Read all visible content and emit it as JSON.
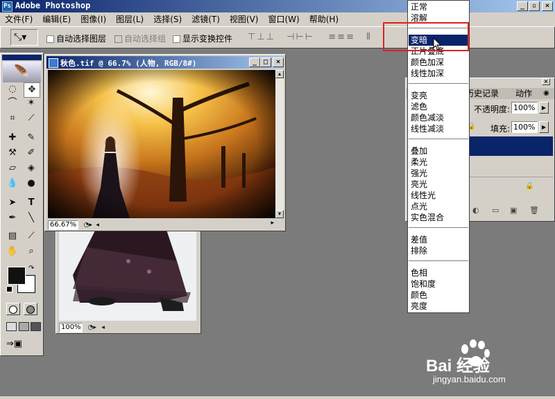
{
  "app": {
    "title": "Adobe Photoshop"
  },
  "menubar": [
    "文件(F)",
    "编辑(E)",
    "图像(I)",
    "图层(L)",
    "选择(S)",
    "滤镜(T)",
    "视图(V)",
    "窗口(W)",
    "帮助(H)"
  ],
  "options": {
    "auto_select_layer": "自动选择图层",
    "auto_select_group": "自动选择组",
    "show_transform": "显示变换控件"
  },
  "document_front": {
    "title": "秋色.tif @ 66.7% (人物, RGB/8#)",
    "zoom": "66.67%"
  },
  "document_back": {
    "zoom": "100%"
  },
  "layers_panel": {
    "tabs": [
      "历史记录",
      "动作"
    ],
    "opacity_label": "不透明度:",
    "opacity_value": "100%",
    "fill_label": "填充:",
    "fill_value": "100%"
  },
  "blend_modes": {
    "groups": [
      [
        "正常",
        "溶解"
      ],
      [
        "变暗",
        "正片叠底",
        "颜色加深",
        "线性加深"
      ],
      [
        "变亮",
        "滤色",
        "颜色减淡",
        "线性减淡"
      ],
      [
        "叠加",
        "柔光",
        "强光",
        "亮光",
        "线性光",
        "点光",
        "实色混合"
      ],
      [
        "差值",
        "排除"
      ],
      [
        "色相",
        "饱和度",
        "颜色",
        "亮度"
      ]
    ],
    "selected": "变暗"
  },
  "watermark": {
    "brand": "Bai 经验",
    "url": "jingyan.baidu.com"
  },
  "colors": {
    "highlight": "#0a246a",
    "annotation": "#e0201c",
    "workspace": "#7b7b7b"
  }
}
